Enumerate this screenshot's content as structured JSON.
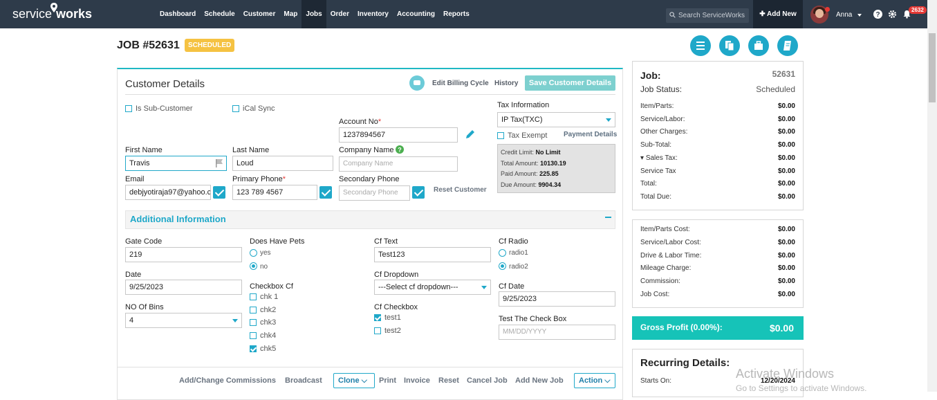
{
  "brand": {
    "part1": "service",
    "part2": "works"
  },
  "nav": [
    "Dashboard",
    "Schedule",
    "Customer",
    "Map",
    "Jobs",
    "Order",
    "Inventory",
    "Accounting",
    "Reports"
  ],
  "search_placeholder": "Search ServiceWorks",
  "add_new": "Add New",
  "user_name": "Anna",
  "notification_count": "2632",
  "job": {
    "title": "JOB #52631",
    "status": "SCHEDULED"
  },
  "customer": {
    "panel_title": "Customer Details",
    "edit_billing": "Edit Billing Cycle",
    "history": "History",
    "save_btn": "Save Customer Details",
    "is_sub_customer": "Is Sub-Customer",
    "ical_sync": "iCal Sync",
    "account_no_label": "Account No",
    "account_no": "1237894567",
    "tax_info_label": "Tax Information",
    "tax_value": "IP Tax(TXC)",
    "tax_exempt": "Tax Exempt",
    "payment_details": "Payment Details",
    "first_name_label": "First Name",
    "first_name": "Travis",
    "last_name_label": "Last Name",
    "last_name": "Loud",
    "company_label": "Company Name",
    "company_placeholder": "Company Name",
    "email_label": "Email",
    "email": "debjyotiraja97@yahoo.com",
    "primary_phone_label": "Primary Phone",
    "primary_phone": "123 789 4567",
    "secondary_phone_label": "Secondary Phone",
    "secondary_phone_placeholder": "Secondary Phone",
    "reset_customer": "Reset Customer",
    "credit": {
      "credit_limit_label": "Credit Limit:",
      "credit_limit": "No Limit",
      "total_amount_label": "Total Amount:",
      "total_amount": "10130.19",
      "paid_amount_label": "Paid Amount:",
      "paid_amount": "225.85",
      "due_amount_label": "Due Amount:",
      "due_amount": "9904.34"
    }
  },
  "additional": {
    "title": "Additional Information",
    "gate_code_label": "Gate Code",
    "gate_code": "219",
    "date_label": "Date",
    "date": "9/25/2023",
    "bins_label": "NO Of Bins",
    "bins": "4",
    "pets_label": "Does Have Pets",
    "pets_yes": "yes",
    "pets_no": "no",
    "checkbox_cf_label": "Checkbox Cf",
    "checkbox_cf": [
      "chk 1",
      "chk2",
      "chk3",
      "chk4",
      "chk5"
    ],
    "cf_text_label": "Cf Text",
    "cf_text": "Test123",
    "cf_dropdown_label": "Cf Dropdown",
    "cf_dropdown": "---Select cf dropdown---",
    "cf_checkbox_label": "Cf Checkbox",
    "cf_checkbox": [
      "test1",
      "test2"
    ],
    "cf_radio_label": "Cf Radio",
    "cf_radio": [
      "radio1",
      "radio2"
    ],
    "cf_date_label": "Cf Date",
    "cf_date": "9/25/2023",
    "test_check_label": "Test The Check Box",
    "test_check_placeholder": "MM/DD/YYYY"
  },
  "footer": {
    "commissions": "Add/Change Commissions",
    "broadcast": "Broadcast",
    "clone": "Clone",
    "print": "Print",
    "invoice": "Invoice",
    "reset": "Reset",
    "cancel": "Cancel Job",
    "add_new_job": "Add New Job",
    "action": "Action"
  },
  "summary": {
    "job_label": "Job:",
    "job_no": "52631",
    "status_label": "Job Status:",
    "status": "Scheduled",
    "rows": [
      {
        "label": "Item/Parts:",
        "value": "$0.00"
      },
      {
        "label": "Service/Labor:",
        "value": "$0.00"
      },
      {
        "label": "Other Charges:",
        "value": "$0.00"
      },
      {
        "label": "Sub-Total:",
        "value": "$0.00"
      },
      {
        "label": "Sales Tax:",
        "value": "$0.00"
      },
      {
        "label": "Service Tax",
        "value": "$0.00"
      },
      {
        "label": "Total:",
        "value": "$0.00"
      },
      {
        "label": "Total Due:",
        "value": "$0.00"
      }
    ],
    "cost_rows": [
      {
        "label": "Item/Parts Cost:",
        "value": "$0.00"
      },
      {
        "label": "Service/Labor Cost:",
        "value": "$0.00"
      },
      {
        "label": "Drive & Labor Time:",
        "value": "$0.00"
      },
      {
        "label": "Mileage Charge:",
        "value": "$0.00"
      },
      {
        "label": "Commission:",
        "value": "$0.00"
      },
      {
        "label": "Job Cost:",
        "value": "$0.00"
      }
    ],
    "gross_label": "Gross Profit (0.00%):",
    "gross_value": "$0.00",
    "recurring_title": "Recurring Details:",
    "starts_on_label": "Starts On:",
    "starts_on": "12/20/2024"
  },
  "watermark": {
    "line1": "Activate Windows",
    "line2": "Go to Settings to activate Windows."
  }
}
